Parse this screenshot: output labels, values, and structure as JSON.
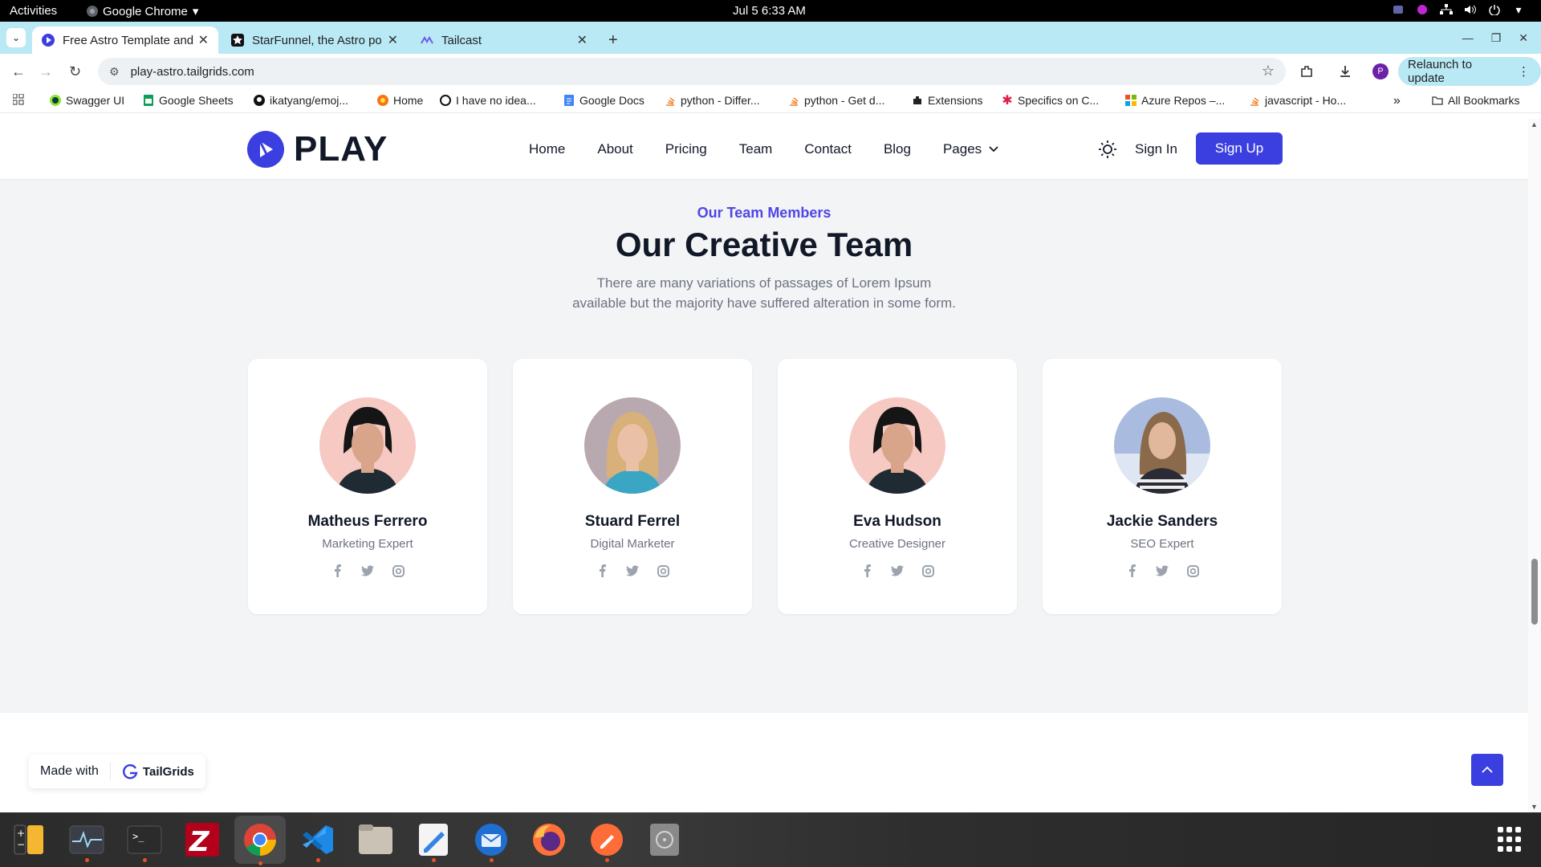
{
  "system": {
    "activities": "Activities",
    "app_menu": "Google Chrome",
    "clock": "Jul 5  6:33 AM"
  },
  "tabs": [
    {
      "title": "Free Astro Template and",
      "active": true
    },
    {
      "title": "StarFunnel, the Astro po",
      "active": false
    },
    {
      "title": "Tailcast",
      "active": false
    }
  ],
  "address_bar": {
    "url": "play-astro.tailgrids.com",
    "relaunch_label": "Relaunch to update",
    "profile_initial": "P"
  },
  "bookmarks": [
    {
      "label": "Swagger UI",
      "icon": "swagger-icon"
    },
    {
      "label": "Google Sheets",
      "icon": "sheets-icon"
    },
    {
      "label": "ikatyang/emoj...",
      "icon": "github-icon"
    },
    {
      "label": "Home",
      "icon": "home-icon"
    },
    {
      "label": "I have no idea...",
      "icon": "globe-icon"
    },
    {
      "label": "Google Docs",
      "icon": "docs-icon"
    },
    {
      "label": "python - Differ...",
      "icon": "stackoverflow-icon"
    },
    {
      "label": "python - Get d...",
      "icon": "stackoverflow-icon"
    },
    {
      "label": "Extensions",
      "icon": "puzzle-icon"
    },
    {
      "label": "Specifics on C...",
      "icon": "asterisk-icon"
    },
    {
      "label": "Azure Repos –...",
      "icon": "azure-icon"
    },
    {
      "label": "javascript - Ho...",
      "icon": "stackoverflow-icon"
    }
  ],
  "all_bookmarks": "All Bookmarks",
  "site": {
    "logo_text": "PLAY",
    "menu": [
      "Home",
      "About",
      "Pricing",
      "Team",
      "Contact",
      "Blog"
    ],
    "pages_label": "Pages",
    "sign_in": "Sign In",
    "sign_up": "Sign Up",
    "accent_color": "#3b3fe0"
  },
  "team": {
    "eyebrow": "Our Team Members",
    "heading": "Our Creative Team",
    "subtitle_line1": "There are many variations of passages of Lorem Ipsum",
    "subtitle_line2": "available but the majority have suffered alteration in some form.",
    "members": [
      {
        "name": "Matheus Ferrero",
        "role": "Marketing Expert"
      },
      {
        "name": "Stuard Ferrel",
        "role": "Digital Marketer"
      },
      {
        "name": "Eva Hudson",
        "role": "Creative Designer"
      },
      {
        "name": "Jackie Sanders",
        "role": "SEO Expert"
      }
    ]
  },
  "made_with": {
    "label": "Made with",
    "brand": "TailGrids"
  },
  "dock": [
    "notes-icon",
    "system-monitor-icon",
    "terminal-icon",
    "filezilla-icon",
    "chrome-icon",
    "vscode-icon",
    "files-icon",
    "text-editor-icon",
    "thunderbird-icon",
    "firefox-icon",
    "postman-icon",
    "disk-icon"
  ]
}
